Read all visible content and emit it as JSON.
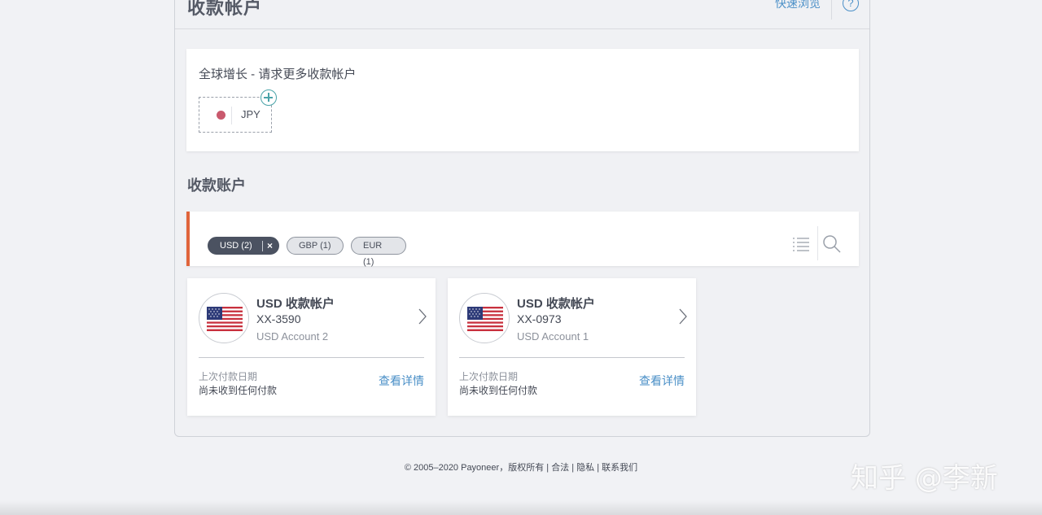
{
  "header": {
    "title": "收款帐户",
    "quick_browse": "快速浏览",
    "help_glyph": "?"
  },
  "growth": {
    "title": "全球增长 - 请求更多收款帐户",
    "currency": "JPY",
    "currency_color": "#c9596d"
  },
  "section": {
    "title": "收款账户"
  },
  "filters": {
    "active": {
      "label": "USD (2)",
      "remove_glyph": "×"
    },
    "others": [
      {
        "label": "GBP (1)"
      },
      {
        "label": "EUR (1)"
      }
    ],
    "accent_color": "#e0643b"
  },
  "accounts": [
    {
      "title": "USD 收款帐户",
      "number": "XX-3590",
      "name": "USD Account 2",
      "last_payment_label": "上次付款日期",
      "last_payment_value": "尚未收到任何付款",
      "details_link": "查看详情",
      "flag": "us-flag-icon"
    },
    {
      "title": "USD 收款帐户",
      "number": "XX-0973",
      "name": "USD Account 1",
      "last_payment_label": "上次付款日期",
      "last_payment_value": "尚未收到任何付款",
      "details_link": "查看详情",
      "flag": "us-flag-icon"
    }
  ],
  "footer": {
    "copyright": "© 2005–2020 Payoneer，版权所有",
    "links": [
      "合法",
      "隐私",
      "联系我们"
    ]
  },
  "watermark": "知乎 @李新",
  "colors": {
    "link": "#4a8fc7",
    "teal": "#4aa3a8"
  }
}
